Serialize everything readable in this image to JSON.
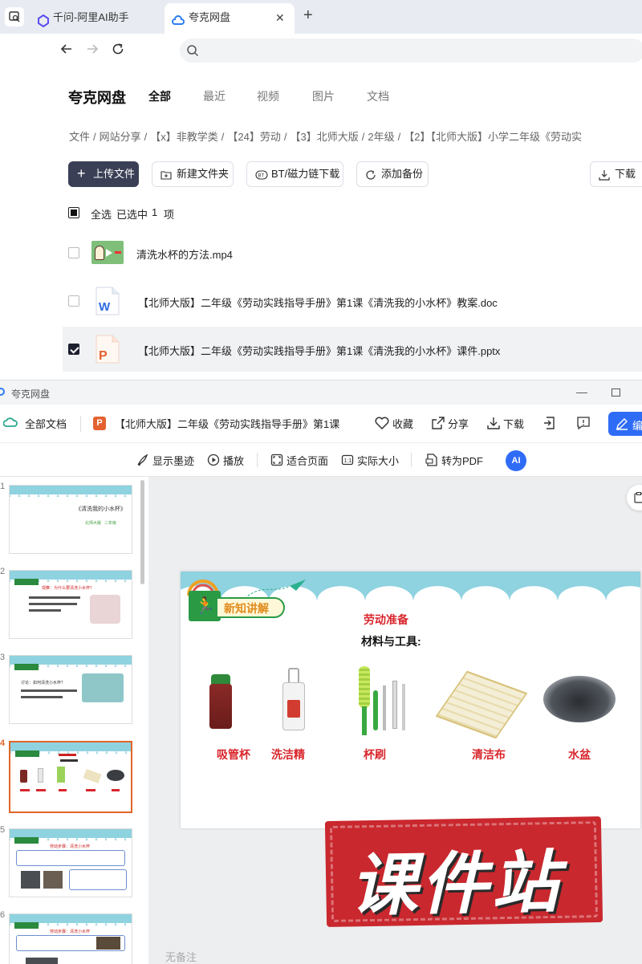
{
  "browser": {
    "tabs": [
      {
        "label": "千问-阿里AI助手",
        "active": false
      },
      {
        "label": "夸克网盘",
        "active": true
      }
    ],
    "new_tab": "+",
    "close": "✕",
    "address": ""
  },
  "drive": {
    "brand": "夸克网盘",
    "nav": [
      "全部",
      "最近",
      "视频",
      "图片",
      "文档"
    ],
    "breadcrumb": [
      "文件",
      "/",
      "网站分享",
      "/",
      "【x】非教学类",
      "/",
      "【24】劳动",
      "/",
      "【3】北师大版",
      "/",
      "2年级",
      "/",
      "【2】【北师大版】小学二年级《劳动实"
    ],
    "actions": {
      "upload": "上传文件",
      "new_folder": "新建文件夹",
      "bt": "BT/磁力链下载",
      "backup": "添加备份",
      "download": "下载"
    },
    "selection": {
      "select_all": "全选",
      "selected_text": "已选中",
      "count": "1",
      "unit": "项"
    },
    "files": [
      {
        "name": "清洗水杯的方法.mp4",
        "type": "video",
        "checked": false
      },
      {
        "name": "【北师大版】二年级《劳动实践指导手册》第1课《清洗我的小水杯》教案.doc",
        "type": "word",
        "checked": false
      },
      {
        "name": "【北师大版】二年级《劳动实践指导手册》第1课《清洗我的小水杯》课件.pptx",
        "type": "ppt",
        "checked": true
      }
    ]
  },
  "viewer": {
    "window_title": "夸克网盘",
    "all_docs": "全部文档",
    "doc_title": "【北师大版】二年级《劳动实践指导手册》第1课",
    "actions": {
      "favorite": "收藏",
      "share": "分享",
      "download": "下载",
      "edit": "编"
    },
    "tools": {
      "ink": "显示墨迹",
      "play": "播放",
      "fit": "适合页面",
      "actual": "实际大小",
      "to_pdf": "转为PDF",
      "ai": "AI"
    },
    "notes_empty": "无备注",
    "thumbs": [
      {
        "num": "1",
        "title": "《清洗我的小水杯》",
        "sub1": "北师大版",
        "sub2": "二年级"
      },
      {
        "num": "2",
        "title": "观察：为什么要清洗小水杯？"
      },
      {
        "num": "3",
        "title": "讨论：如何清洗小水杯？"
      },
      {
        "num": "4",
        "current": true
      },
      {
        "num": "5",
        "title": "劳动步骤：清洗小水杯"
      },
      {
        "num": "6",
        "title": "劳动步骤：清洗小水杯"
      }
    ]
  },
  "slide": {
    "section_tag": "新知讲解",
    "heading": "劳动准备",
    "subheading": "材料与工具:",
    "items": [
      "吸管杯",
      "洗洁精",
      "杯刷",
      "清洁布",
      "水盆"
    ],
    "watermark": "课件站"
  }
}
